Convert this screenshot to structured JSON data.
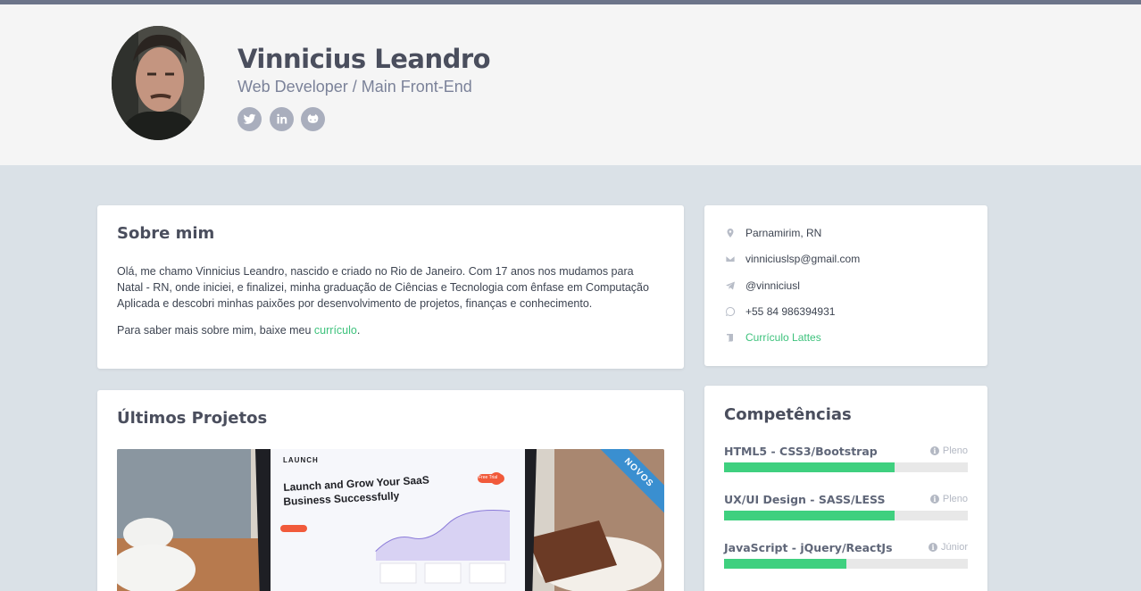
{
  "profile": {
    "name": "Vinnicius Leandro",
    "role": "Web Developer / Main Front-End",
    "social": [
      {
        "icon": "twitter-icon"
      },
      {
        "icon": "linkedin-icon"
      },
      {
        "icon": "github-icon"
      }
    ]
  },
  "about": {
    "title": "Sobre mim",
    "paragraph": "Olá, me chamo Vinnicius Leandro, nascido e criado no Rio de Janeiro. Com 17 anos nos mudamos para Natal - RN, onde iniciei, e finalizei, minha graduação de Ciências e Tecnologia com ênfase em Computação Aplicada e descobri minhas paixões por desenvolvimento de projetos, finanças e conhecimento.",
    "cv_prefix": "Para saber mais sobre mim, baixe meu ",
    "cv_link": "currículo",
    "cv_suffix": "."
  },
  "contact": {
    "location": "Parnamirim, RN",
    "email": "vinniciuslsp@gmail.com",
    "telegram": "@vinniciusl",
    "whatsapp": "+55 84 986394931",
    "lattes": "Currículo Lattes"
  },
  "projects": {
    "title": "Últimos Projetos",
    "ribbon": "NOVOS",
    "preview": {
      "brand": "LAUNCH",
      "headline_1": "Launch and Grow Your SaaS",
      "headline_2": "Business Successfully",
      "cta": "Free Trial"
    }
  },
  "skills": {
    "title": "Competências",
    "items": [
      {
        "label": "HTML5 - CSS3/Bootstrap",
        "level": "Pleno",
        "percent": 70
      },
      {
        "label": "UX/UI Design - SASS/LESS",
        "level": "Pleno",
        "percent": 70
      },
      {
        "label": "JavaScript - jQuery/ReactJs",
        "level": "Júnior",
        "percent": 50
      }
    ]
  },
  "colors": {
    "accent": "#3dc27c",
    "skill_bar": "#3fd07f",
    "ribbon": "#3a8fd0",
    "topbar": "#6c7489"
  }
}
